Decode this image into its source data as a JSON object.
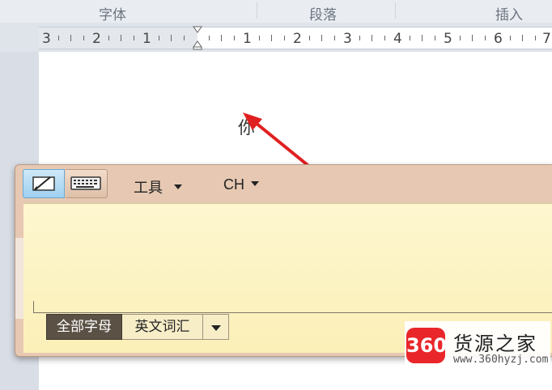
{
  "ribbon": {
    "groups": [
      "字体",
      "段落",
      "插入"
    ]
  },
  "ruler": {
    "labels": [
      "3",
      "2",
      "1",
      "1",
      "2",
      "3",
      "4",
      "5",
      "6",
      "7"
    ]
  },
  "document": {
    "text": "你"
  },
  "handwriting_panel": {
    "tools_menu": "工具",
    "language_menu": "CH",
    "mode_all_letters": "全部字母",
    "mode_english_vocab": "英文词汇"
  },
  "watermark": {
    "badge": "360",
    "name": "货源之家",
    "url": "www.360hyzj.com"
  },
  "colors": {
    "arrow": "#e02020",
    "panel_frame": "#e7c9b3",
    "writing_area": "#fcf0b8",
    "active_tool": "#9fd0f0",
    "badge_red": "#e9262a"
  },
  "icons": {
    "pen_tool": "pen-tablet-icon",
    "keyboard_tool": "keyboard-icon"
  }
}
